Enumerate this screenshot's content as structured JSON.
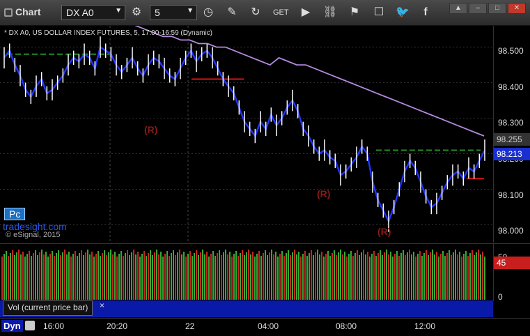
{
  "toolbar": {
    "title": "Chart",
    "symbol": "DX A0",
    "interval": "5"
  },
  "chart_info": "* DX A0, US DOLLAR INDEX FUTURES, 5, 17:00-16:59 (Dynamic)",
  "price_axis": {
    "labels": [
      "98.500",
      "98.400",
      "98.300",
      "98.200",
      "98.100",
      "98.000"
    ],
    "tag_upper": "98.255",
    "tag_current": "98.213"
  },
  "watermark": {
    "pc": "Pc",
    "brand": "tradesight.com",
    "copyright": "© eSignal, 2015"
  },
  "r_markers": [
    "(R)",
    "(R)",
    "(R)",
    "(R)"
  ],
  "volume": {
    "label": "Vol (current price bar)",
    "close": "×",
    "axis_top": "50",
    "axis_zero": "0",
    "tag": "45"
  },
  "time_axis": {
    "dyn": "Dyn",
    "labels": [
      "16:00",
      "20:20",
      "22",
      "04:00",
      "08:00",
      "12:00"
    ]
  },
  "colors": {
    "price_line": "#2233ff",
    "ma_line": "#b58ae0",
    "green_level": "#1f8f1f",
    "red_level": "#dd1111",
    "vol_up": "#33aa33",
    "vol_down": "#cc2222"
  },
  "chart_data": {
    "type": "line",
    "ylim": [
      97.95,
      98.56
    ],
    "price": [
      98.47,
      98.49,
      98.45,
      98.42,
      98.38,
      98.36,
      98.39,
      98.41,
      98.37,
      98.38,
      98.4,
      98.42,
      98.45,
      98.47,
      98.46,
      98.48,
      98.47,
      98.44,
      98.5,
      98.49,
      98.48,
      98.45,
      98.43,
      98.45,
      98.47,
      98.44,
      98.42,
      98.45,
      98.47,
      98.46,
      98.44,
      98.42,
      98.41,
      98.44,
      98.47,
      98.49,
      98.46,
      98.48,
      98.49,
      98.47,
      98.44,
      98.41,
      98.39,
      98.37,
      98.33,
      98.29,
      98.27,
      98.25,
      98.29,
      98.27,
      98.31,
      98.28,
      98.3,
      98.33,
      98.35,
      98.32,
      98.27,
      98.25,
      98.22,
      98.2,
      98.21,
      98.19,
      98.18,
      98.14,
      98.15,
      98.17,
      98.19,
      98.22,
      98.2,
      98.12,
      98.07,
      98.04,
      98.01,
      98.05,
      98.1,
      98.15,
      98.18,
      98.16,
      98.12,
      98.08,
      98.05,
      98.06,
      98.09,
      98.12,
      98.14,
      98.15,
      98.13,
      98.16,
      98.15,
      98.18,
      98.21
    ],
    "ma": [
      98.58,
      98.57,
      98.56,
      98.55,
      98.54,
      98.53,
      98.53,
      98.52,
      98.52,
      98.51,
      98.51,
      98.5,
      98.5,
      98.49,
      98.48,
      98.47,
      98.46,
      98.45,
      98.47,
      98.46,
      98.45,
      98.45,
      98.44,
      98.43,
      98.42,
      98.41,
      98.4,
      98.39,
      98.38,
      98.37,
      98.36,
      98.35,
      98.34,
      98.33,
      98.32,
      98.31,
      98.3,
      98.29,
      98.28,
      98.27,
      98.26,
      98.25
    ],
    "levels": [
      {
        "value": 98.48,
        "color": "green"
      },
      {
        "value": 98.41,
        "color": "red"
      },
      {
        "value": 98.21,
        "color": "green"
      },
      {
        "value": 98.13,
        "color": "red"
      }
    ]
  }
}
